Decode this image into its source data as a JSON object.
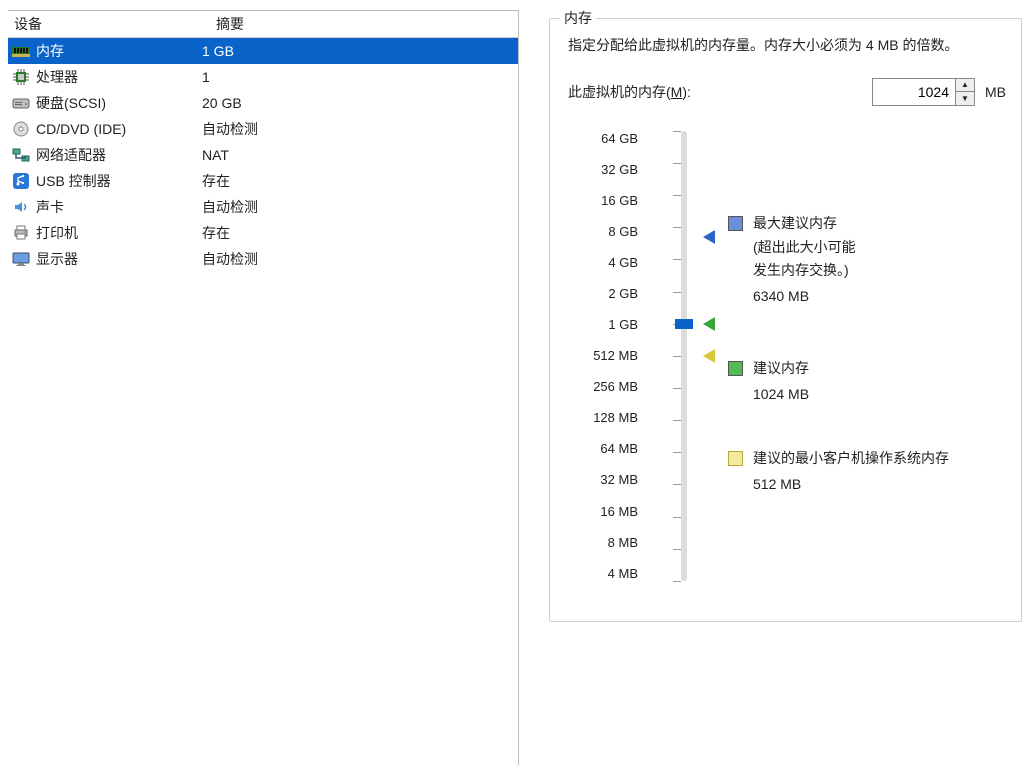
{
  "left": {
    "header_device": "设备",
    "header_summary": "摘要",
    "rows": [
      {
        "icon": "memory-icon",
        "name": "内存",
        "summary": "1 GB",
        "selected": true
      },
      {
        "icon": "cpu-icon",
        "name": "处理器",
        "summary": "1"
      },
      {
        "icon": "hdd-icon",
        "name": "硬盘(SCSI)",
        "summary": "20 GB"
      },
      {
        "icon": "disc-icon",
        "name": "CD/DVD (IDE)",
        "summary": "自动检测"
      },
      {
        "icon": "nic-icon",
        "name": "网络适配器",
        "summary": "NAT"
      },
      {
        "icon": "usb-icon",
        "name": "USB 控制器",
        "summary": "存在"
      },
      {
        "icon": "sound-icon",
        "name": "声卡",
        "summary": "自动检测"
      },
      {
        "icon": "printer-icon",
        "name": "打印机",
        "summary": "存在"
      },
      {
        "icon": "display-icon",
        "name": "显示器",
        "summary": "自动检测"
      }
    ]
  },
  "right": {
    "group_title": "内存",
    "desc_a": "指定分配给此虚拟机的内存量。内存大小必须为 4 MB 的倍数。",
    "mem_label_pre": "此虚拟机的内存(",
    "mem_label_hot": "M",
    "mem_label_post": "):",
    "mem_value": "1024",
    "mem_unit": "MB",
    "ticks": [
      "64 GB",
      "32 GB",
      "16 GB",
      "8 GB",
      "4 GB",
      "2 GB",
      "1 GB",
      "512 MB",
      "256 MB",
      "128 MB",
      "64 MB",
      "32 MB",
      "16 MB",
      "8 MB",
      "4 MB"
    ],
    "selected_tick_index": 6,
    "markers": {
      "max": {
        "label": "最大建议内存",
        "note1": "(超出此大小可能",
        "note2": "发生内存交换。)",
        "value": "6340 MB",
        "tick_pos": 3.3
      },
      "rec": {
        "label": "建议内存",
        "value": "1024 MB",
        "tick_pos": 6
      },
      "min": {
        "label": "建议的最小客户机操作系统内存",
        "value": "512 MB",
        "tick_pos": 7
      }
    }
  }
}
